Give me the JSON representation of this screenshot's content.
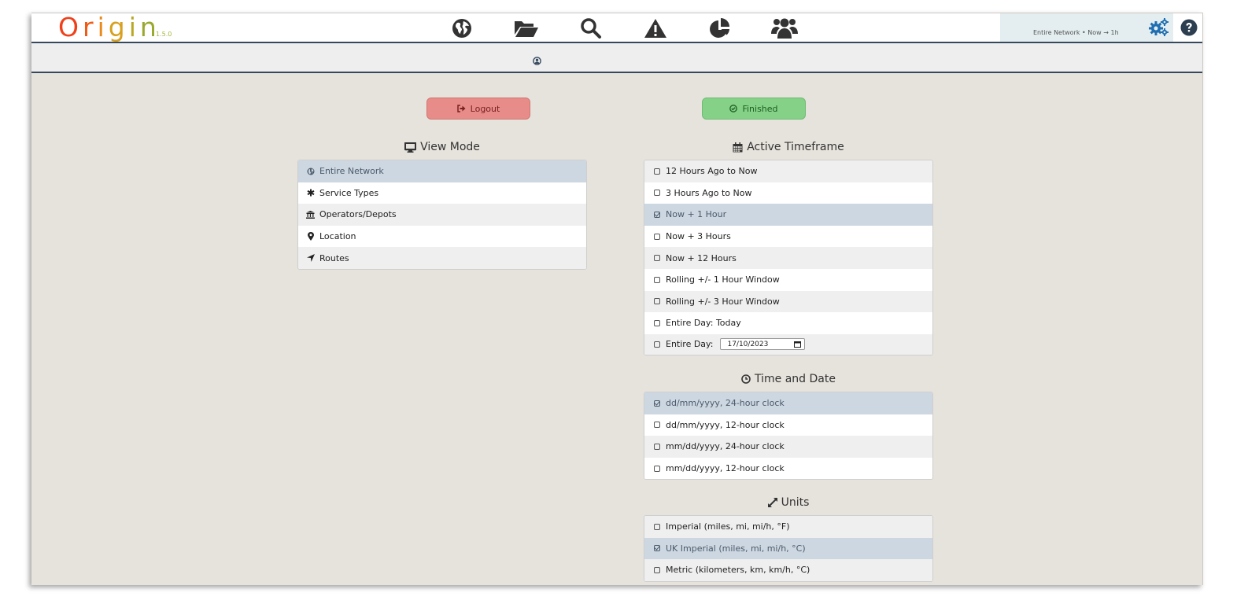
{
  "app": {
    "logo_letters": [
      "O",
      "r",
      "i",
      "g",
      "i",
      "n"
    ],
    "logo_colors": [
      "#f0401a",
      "#f05a14",
      "#e98a1a",
      "#d7a01e",
      "#b8a826",
      "#9aa82e"
    ],
    "version": "1.5.0"
  },
  "nav": {
    "icons": [
      "globe-icon",
      "folder-open-icon",
      "search-icon",
      "warning-icon",
      "pie-chart-icon",
      "users-icon"
    ]
  },
  "status": {
    "summary": "Entire Network • Now → 1h"
  },
  "buttons": {
    "logout": "Logout",
    "finished": "Finished"
  },
  "colors": {
    "accent": "#1f6fb2",
    "dark": "#34495e",
    "selected_row": "#cdd7e1",
    "logout_bg": "#e78c89",
    "finished_bg": "#84d187"
  },
  "view_mode": {
    "title": "View Mode",
    "items": [
      {
        "label": "Entire Network",
        "icon": "globe-icon",
        "selected": true
      },
      {
        "label": "Service Types",
        "icon": "asterisk-icon",
        "selected": false
      },
      {
        "label": "Operators/Depots",
        "icon": "bank-icon",
        "selected": false
      },
      {
        "label": "Location",
        "icon": "map-marker-icon",
        "selected": false
      },
      {
        "label": "Routes",
        "icon": "location-arrow-icon",
        "selected": false
      }
    ]
  },
  "timeframe": {
    "title": "Active Timeframe",
    "items": [
      {
        "label": "12 Hours Ago to Now",
        "checked": false
      },
      {
        "label": "3 Hours Ago to Now",
        "checked": false
      },
      {
        "label": "Now + 1 Hour",
        "checked": true
      },
      {
        "label": "Now + 3 Hours",
        "checked": false
      },
      {
        "label": "Now + 12 Hours",
        "checked": false
      },
      {
        "label": "Rolling +/- 1 Hour Window",
        "checked": false
      },
      {
        "label": "Rolling +/- 3 Hour Window",
        "checked": false
      },
      {
        "label": "Entire Day: Today",
        "checked": false
      },
      {
        "label": "Entire Day:",
        "checked": false,
        "date_value": "17/10/2023"
      }
    ]
  },
  "time_date": {
    "title": "Time and Date",
    "items": [
      {
        "label": "dd/mm/yyyy, 24-hour clock",
        "checked": true
      },
      {
        "label": "dd/mm/yyyy, 12-hour clock",
        "checked": false
      },
      {
        "label": "mm/dd/yyyy, 24-hour clock",
        "checked": false
      },
      {
        "label": "mm/dd/yyyy, 12-hour clock",
        "checked": false
      }
    ]
  },
  "units": {
    "title": "Units",
    "items": [
      {
        "label": "Imperial (miles, mi, mi/h, °F)",
        "checked": false
      },
      {
        "label": "UK Imperial (miles, mi, mi/h, °C)",
        "checked": true
      },
      {
        "label": "Metric (kilometers, km, km/h, °C)",
        "checked": false
      }
    ]
  }
}
